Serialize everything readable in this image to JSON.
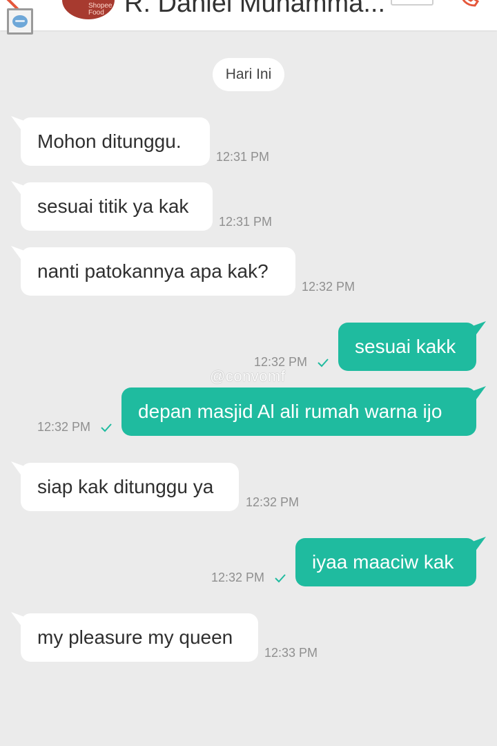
{
  "header": {
    "contact_name": "R. Daniel Muhamma...",
    "avatar_text": "Shopee Food"
  },
  "date_separator": "Hari Ini",
  "watermark": "@convomf",
  "messages": [
    {
      "direction": "incoming",
      "text": "Mohon ditunggu.",
      "time": "12:31 PM"
    },
    {
      "direction": "incoming",
      "text": "sesuai titik ya kak",
      "time": "12:31 PM"
    },
    {
      "direction": "incoming",
      "text": "nanti patokannya apa kak?",
      "time": "12:32 PM"
    },
    {
      "direction": "outgoing",
      "text": "sesuai kakk",
      "time": "12:32 PM",
      "status": "sent-check-icon"
    },
    {
      "direction": "outgoing",
      "text": "depan masjid Al ali rumah warna ijo",
      "time": "12:32 PM",
      "status": "sent-check-icon"
    },
    {
      "direction": "incoming",
      "text": "siap kak ditunggu ya",
      "time": "12:32 PM"
    },
    {
      "direction": "outgoing",
      "text": "iyaa maaciw kak",
      "time": "12:32 PM",
      "status": "sent-check-icon"
    },
    {
      "direction": "incoming",
      "text": "my pleasure my queen",
      "time": "12:33 PM"
    }
  ],
  "colors": {
    "background": "#ebebeb",
    "outgoing_bubble": "#1fbb9f",
    "incoming_bubble": "#ffffff",
    "accent": "#e5573b",
    "timestamp": "#8f8f8f"
  }
}
